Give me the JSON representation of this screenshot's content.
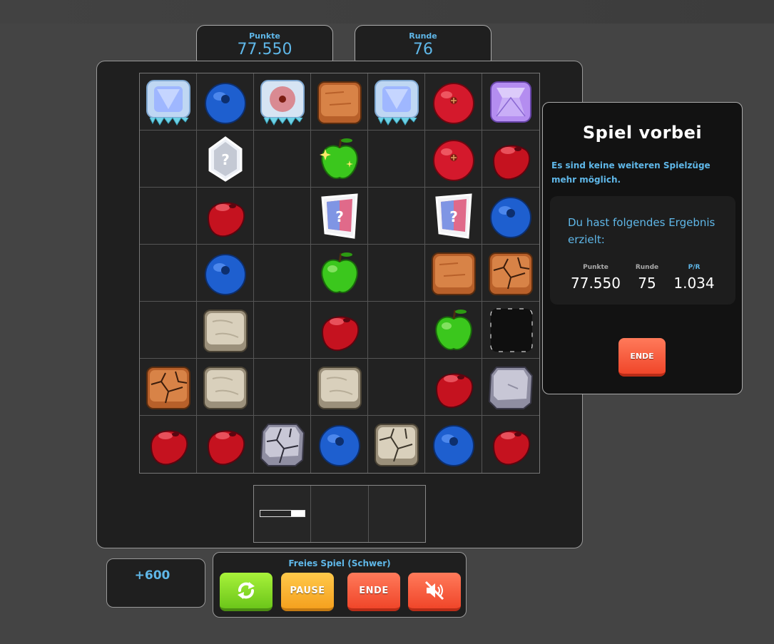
{
  "stats": {
    "points": {
      "label": "Punkte",
      "value": "77.550"
    },
    "round": {
      "label": "Runde",
      "value": "76"
    }
  },
  "board": {
    "rows": 7,
    "cols": 7,
    "cells": [
      [
        "ice-cube-frozen",
        "blueberry",
        "red-berry-frozen",
        "wood-block",
        "ice-cube-frozen",
        "red-berry",
        "purple-gem"
      ],
      [
        "empty",
        "mystery-box",
        "empty",
        "green-apple-sparkle",
        "empty",
        "red-berry",
        "cherry"
      ],
      [
        "empty",
        "cherry",
        "empty",
        "mystery-box-color",
        "empty",
        "mystery-box-color",
        "blueberry"
      ],
      [
        "empty",
        "blueberry",
        "empty",
        "green-apple",
        "empty",
        "wood-block",
        "wood-block-cracked"
      ],
      [
        "empty",
        "stone-block",
        "empty",
        "cherry",
        "empty",
        "green-apple",
        "black-block"
      ],
      [
        "wood-block-cracked",
        "stone-block",
        "empty",
        "stone-block",
        "empty",
        "cherry",
        "gray-stone-block"
      ],
      [
        "cherry",
        "cherry",
        "gray-stone-cracked",
        "blueberry",
        "stone-block-cracked",
        "blueberry",
        "cherry"
      ]
    ]
  },
  "queue": {
    "slots": 3,
    "progress": 0.3
  },
  "score_delta": "+600",
  "controls": {
    "mode_title": "Freies Spiel (Schwer)",
    "restart_icon": "restart-icon",
    "pause_label": "PAUSE",
    "end_label": "ENDE",
    "mute_icon": "sound-muted-icon"
  },
  "game_over": {
    "title": "Spiel vorbei",
    "message": "Es sind keine weiteren Spielzüge mehr möglich.",
    "result_intro": "Du hast folgendes Ergebnis erzielt:",
    "points_label": "Punkte",
    "points_value": "77.550",
    "round_label": "Runde",
    "round_value": "75",
    "ratio_label": "P/R",
    "ratio_value": "1.034",
    "end_label": "ENDE"
  },
  "colors": {
    "accent": "#5fb7e8",
    "panel": "#1f1f1f",
    "background": "#444444"
  }
}
